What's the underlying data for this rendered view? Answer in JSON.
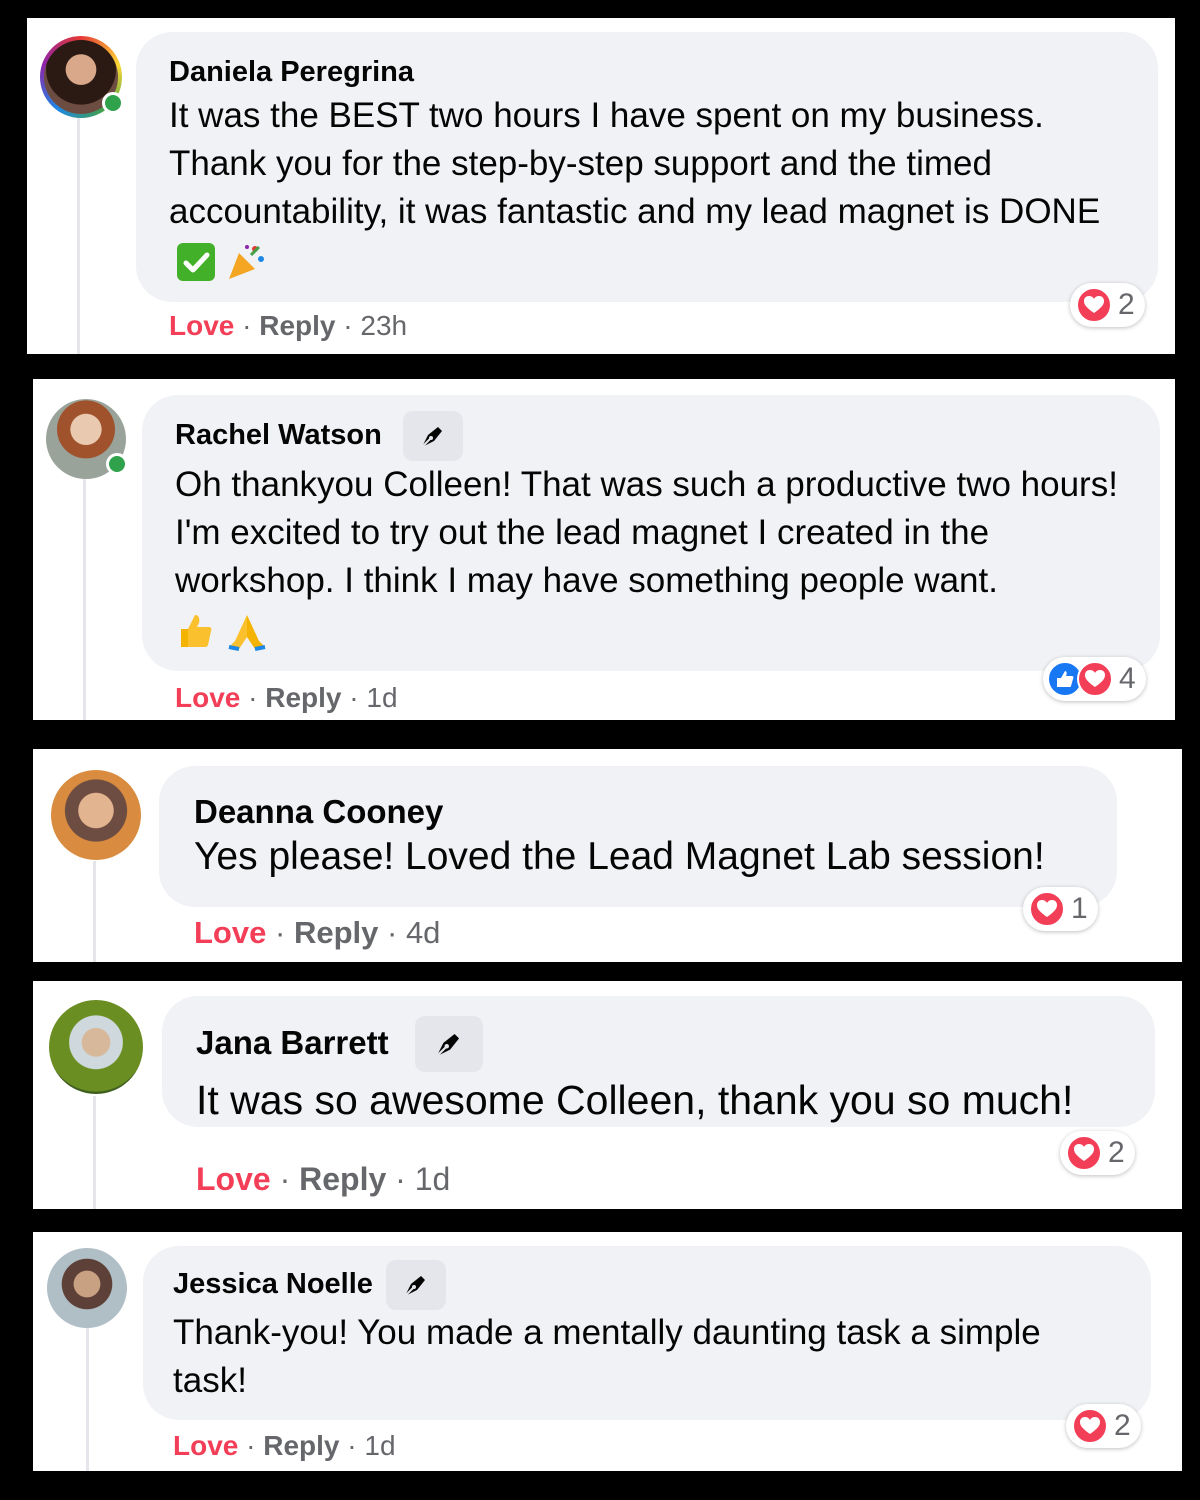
{
  "comments": [
    {
      "name": "Daniela Peregrina",
      "text": "It was the BEST two hours I have spent on my business. Thank you for the step-by-step support and the timed accountability, it was fantastic and my lead magnet is DONE",
      "emoji": [
        "check-mark-icon",
        "party-popper-icon"
      ],
      "love": "Love",
      "reply": "Reply",
      "sep": "·",
      "time": "23h",
      "reaction_count": "2",
      "reaction_icons": [
        "heart-icon"
      ],
      "online": true,
      "author_badge": false
    },
    {
      "name": "Rachel Watson",
      "text": "Oh thankyou Colleen! That was such a productive two hours! I'm excited to try out the lead magnet I created in the workshop. I think I may have something people want.",
      "emoji": [
        "thumbs-up-icon",
        "praying-hands-icon"
      ],
      "love": "Love",
      "reply": "Reply",
      "sep": "·",
      "time": "1d",
      "reaction_count": "4",
      "reaction_icons": [
        "like-icon",
        "heart-icon"
      ],
      "online": true,
      "author_badge": true
    },
    {
      "name": "Deanna Cooney",
      "text": "Yes please! Loved the Lead Magnet Lab session!",
      "emoji": [],
      "love": "Love",
      "reply": "Reply",
      "sep": "·",
      "time": "4d",
      "reaction_count": "1",
      "reaction_icons": [
        "heart-icon"
      ],
      "online": false,
      "author_badge": false
    },
    {
      "name": "Jana Barrett",
      "text": "It was so awesome Colleen, thank you so much!",
      "emoji": [],
      "love": "Love",
      "reply": "Reply",
      "sep": "·",
      "time": "1d",
      "reaction_count": "2",
      "reaction_icons": [
        "heart-icon"
      ],
      "online": false,
      "author_badge": true
    },
    {
      "name": "Jessica Noelle",
      "text": "Thank-you! You made a mentally daunting task a simple task!",
      "emoji": [],
      "love": "Love",
      "reply": "Reply",
      "sep": "·",
      "time": "1d",
      "reaction_count": "2",
      "reaction_icons": [
        "heart-icon"
      ],
      "online": false,
      "author_badge": true
    }
  ],
  "colors": {
    "love": "#f33e58",
    "meta": "#65676b",
    "bubble": "#f0f2f5",
    "online": "#31a24c",
    "like": "#1877f2"
  }
}
